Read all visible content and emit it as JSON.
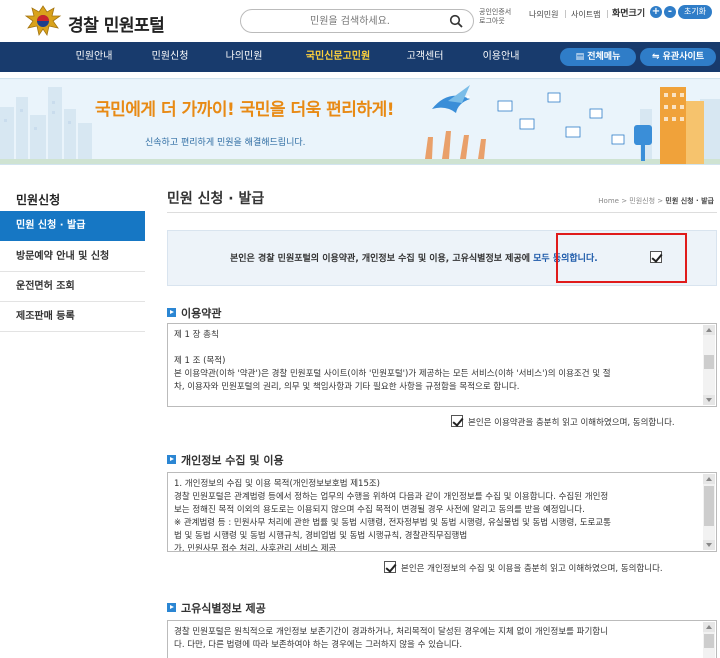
{
  "header": {
    "site_title": "경찰 민원포털",
    "search_placeholder": "민원을 검색하세요.",
    "utility_left": "공인인증서 로그아웃",
    "utility_links": [
      "나의민원",
      "사이트맵"
    ],
    "font_size_label": "화면크기",
    "font_plus": "+",
    "font_minus": "-",
    "reset_label": "초기화"
  },
  "nav": {
    "items": [
      "민원안내",
      "민원신청",
      "나의민원",
      "국민신문고민원",
      "고객센터",
      "이용안내"
    ],
    "active_index": 3,
    "all_menu": "전체메뉴",
    "related_sites": "유관사이트"
  },
  "banner": {
    "title": "국민에게 더 가까이! 국민을 더욱 편리하게!",
    "subtitle": "신속하고 편리하게 민원을 해결해드립니다."
  },
  "sidebar": {
    "heading": "민원신청",
    "items": [
      "민원 신청 · 발급",
      "방문예약 안내 및 신청",
      "운전면허 조회",
      "제조판매 등록"
    ],
    "active_index": 0
  },
  "main": {
    "page_title": "민원 신청 · 발급",
    "breadcrumb": {
      "home": "Home",
      "parent": "민원신청",
      "current": "민원 신청 · 발급"
    },
    "agree_all_text": "본인은 경찰 민원포털의 이용약관, 개인정보 수집 및 이용, 고유식별정보 제공에",
    "agree_all_link": "모두 동의합니다.",
    "agree_all_checked": true,
    "sections": [
      {
        "title": "이용약관",
        "lines": [
          "제 1 장 총칙",
          "",
          "제 1 조 (목적)",
          "본 이용약관(이하 '약관')은 경찰 민원포털 사이트(이하 '민원포털')가 제공하는 모든 서비스(이하 '서비스')의 이용조건 및 절",
          "차, 이용자와 민원포털의 권리, 의무 및 책임사항과 기타 필요한 사항을 규정함을 목적으로 합니다."
        ],
        "consent": "본인은 이용약관을 충분히 읽고 이해하였으며, 동의합니다.",
        "checked": true
      },
      {
        "title": "개인정보 수집 및 이용",
        "lines": [
          "1. 개인정보의 수집 및 이용 목적(개인정보보호법 제15조)",
          "경찰 민원포털은 관계법령 등에서 정하는 업무의 수행을 위하여 다음과 같이 개인정보를 수집 및 이용합니다. 수집된 개인정",
          "보는 정해진 목적 이외의 용도로는 이용되지 않으며 수집 목적이 변경될 경우 사전에 알리고 동의를 받을 예정입니다.",
          "※ 관계법령 등 : 민원사무 처리에 관한 법률 및 동법 시행령, 전자정부법 및 동법 시행령, 유실물법 및 동법 시행령, 도로교통",
          "법 및 동법 시행령 및 동법 시행규칙, 경비업법 및 동법 시행규칙, 경찰관직무집행법",
          "가. 민원사무 접수 처리, 사후관리 서비스 제공"
        ],
        "consent": "본인은 개인정보의 수집 및 이용을 충분히 읽고 이해하였으며, 동의합니다.",
        "checked": true
      },
      {
        "title": "고유식별정보 제공",
        "lines": [
          "경찰 민원포털은 원칙적으로 개인정보 보존기간이 경과하거나, 처리목적이 달성된 경우에는 지체 없이 개인정보를 파기합니",
          "다. 다만, 다른 법령에 따라 보존하여야 하는 경우에는 그러하지 않을 수 있습니다."
        ]
      }
    ]
  },
  "colors": {
    "nav_bg": "#183b6d",
    "nav_active": "#ffd23c",
    "accent_blue": "#1677c4",
    "button_blue": "#2f7dc8",
    "banner_orange": "#e88a14",
    "highlight_red": "#e01b1b"
  }
}
